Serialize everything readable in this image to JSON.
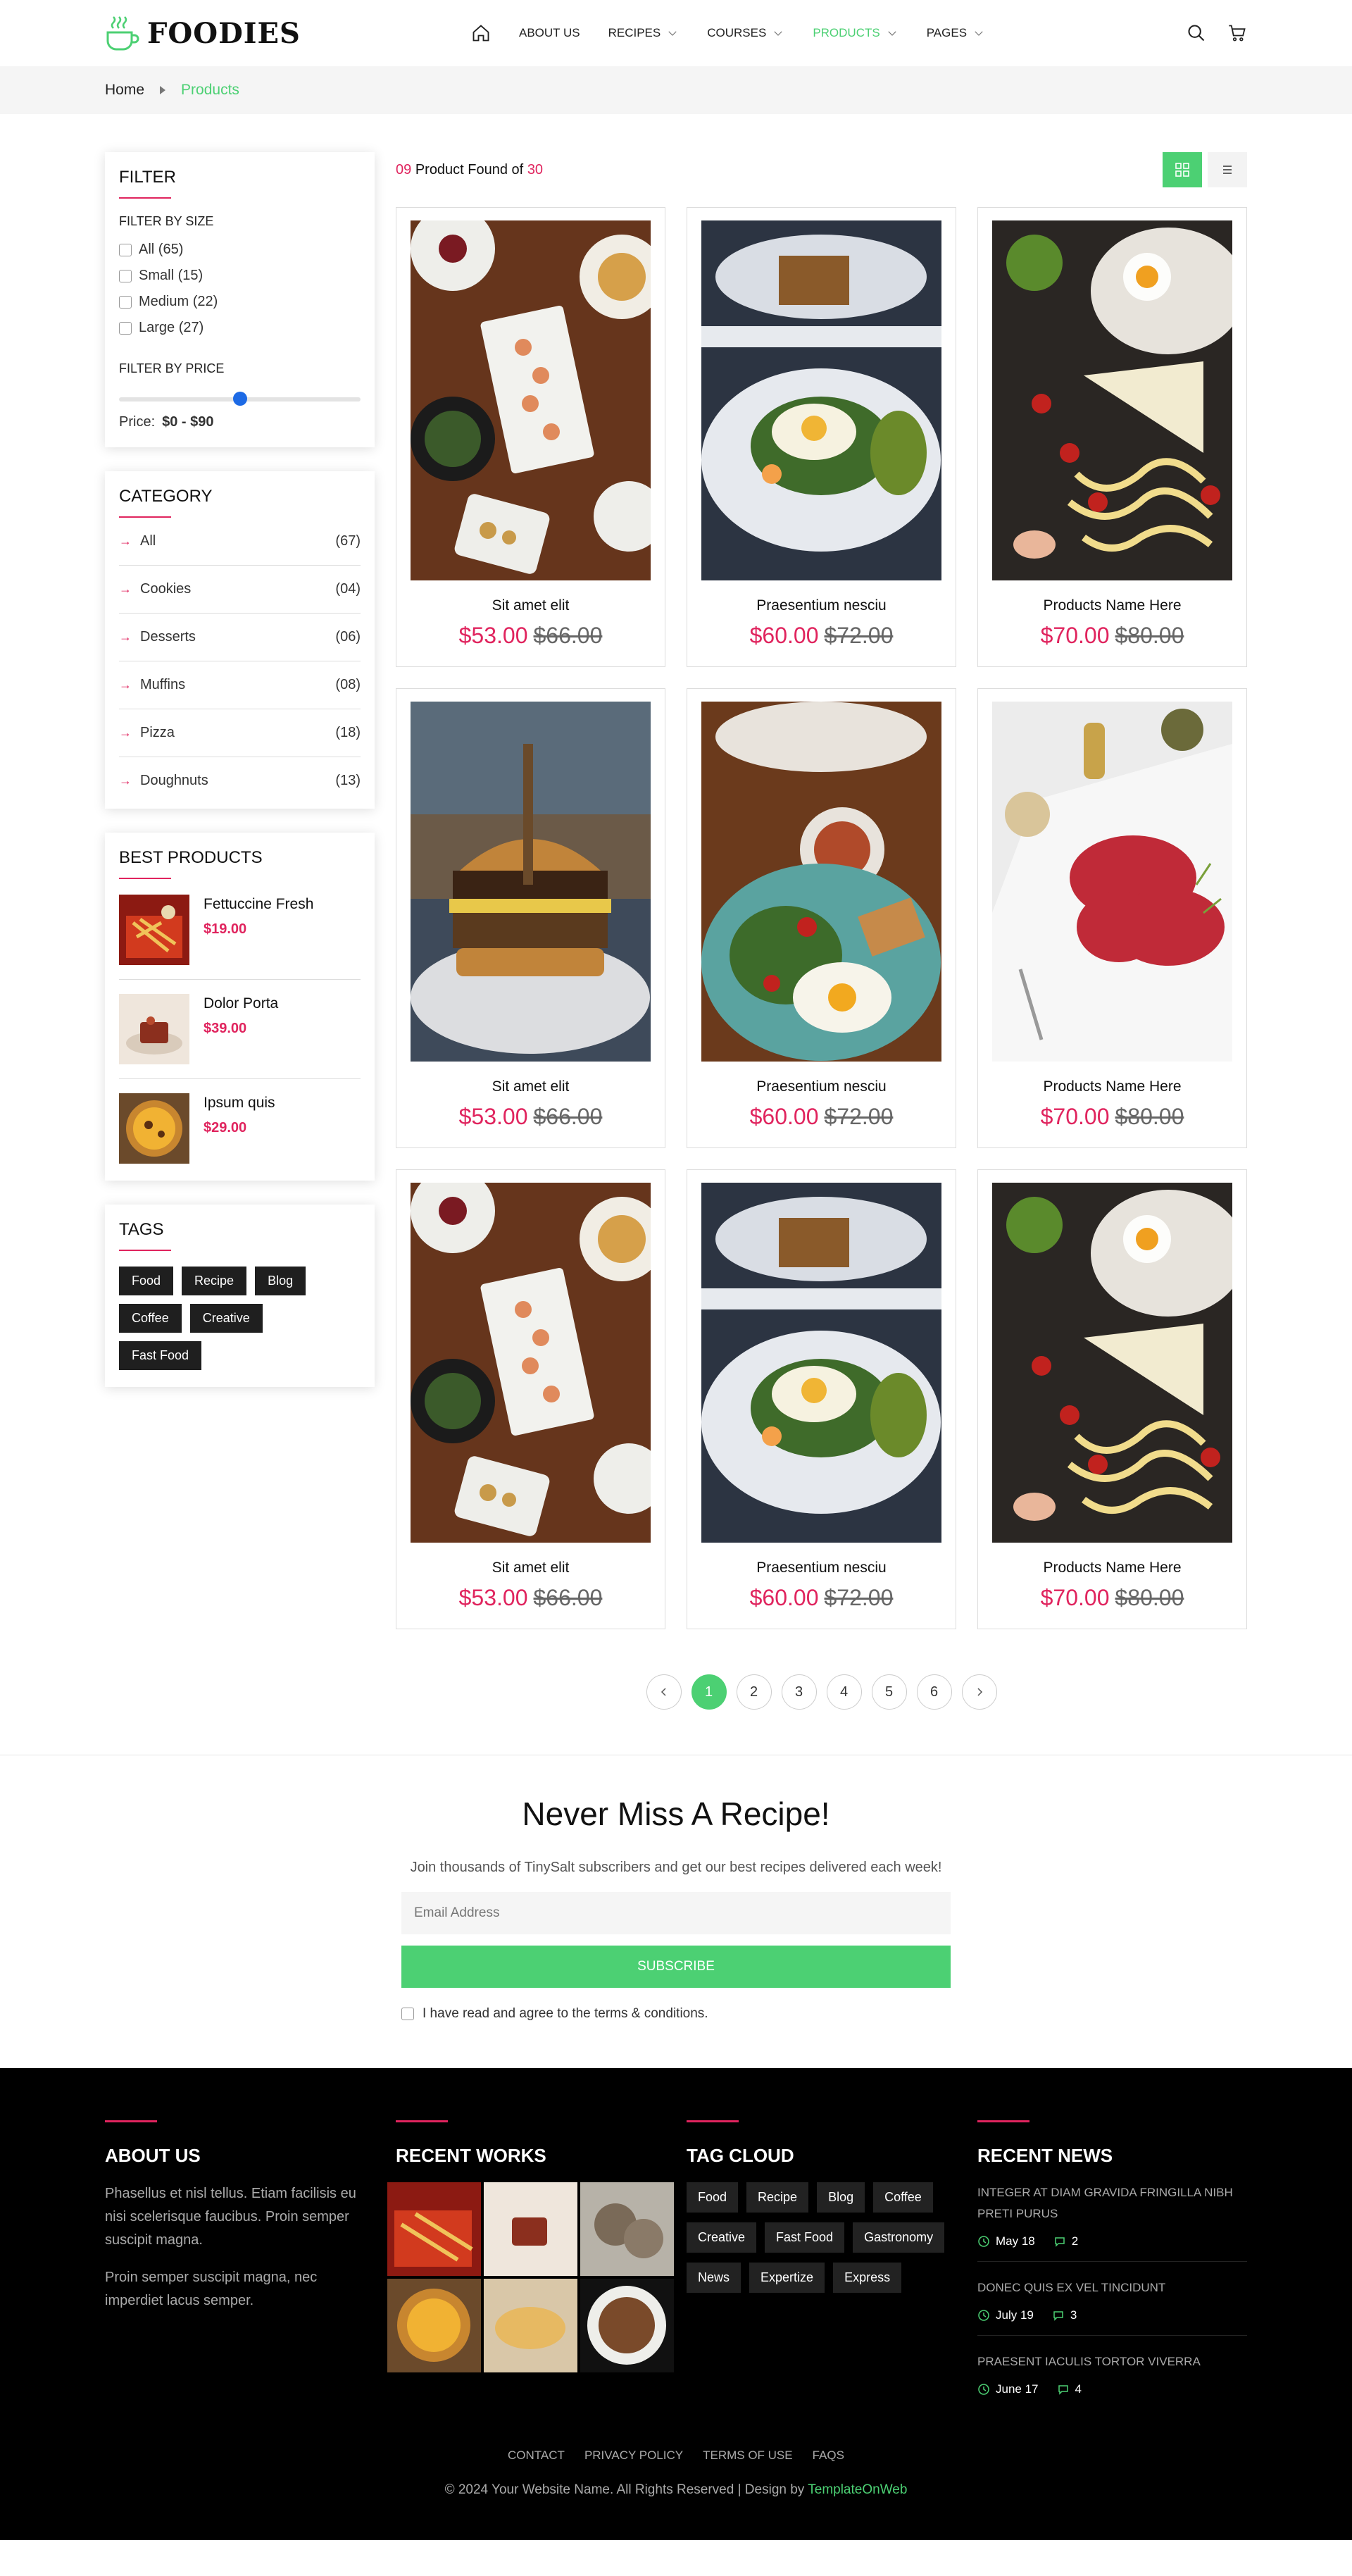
{
  "brand": {
    "name": "FOODIES",
    "accent": "#4cd073",
    "highlight": "#e0245e"
  },
  "nav": [
    {
      "label": "About Us",
      "dropdown": false,
      "active": false
    },
    {
      "label": "Recipes",
      "dropdown": true,
      "active": false
    },
    {
      "label": "Courses",
      "dropdown": true,
      "active": false
    },
    {
      "label": "Products",
      "dropdown": true,
      "active": true
    },
    {
      "label": "Pages",
      "dropdown": true,
      "active": false
    }
  ],
  "breadcrumb": {
    "home": "Home",
    "current": "Products"
  },
  "filter": {
    "title": "Filter",
    "size_title": "Filter by size",
    "sizes": [
      "All (65)",
      "Small (15)",
      "Medium (22)",
      "Large (27)"
    ],
    "price_title": "Filter by price",
    "price_label": "Price:",
    "price_value": "$0 - $90",
    "price_slider_fraction": 0.5
  },
  "category": {
    "title": "Category",
    "items": [
      {
        "name": "All",
        "count": "(67)"
      },
      {
        "name": "Cookies",
        "count": "(04)"
      },
      {
        "name": "Desserts",
        "count": "(06)"
      },
      {
        "name": "Muffins",
        "count": "(08)"
      },
      {
        "name": "Pizza",
        "count": "(18)"
      },
      {
        "name": "Doughnuts",
        "count": "(13)"
      }
    ]
  },
  "best_products": {
    "title": "Best Products",
    "items": [
      {
        "name": "Fettuccine Fresh",
        "price": "$19.00"
      },
      {
        "name": "Dolor Porta",
        "price": "$39.00"
      },
      {
        "name": "Ipsum quis",
        "price": "$29.00"
      }
    ]
  },
  "tags": {
    "title": "Tags",
    "items": [
      "Food",
      "Recipe",
      "Blog",
      "Coffee",
      "Creative",
      "Fast Food"
    ]
  },
  "results": {
    "count": "09",
    "text": "Product Found of",
    "total": "30"
  },
  "products": [
    {
      "name": "Sit amet elit",
      "price": "$53.00",
      "old_price": "$66.00",
      "image": "salmon-plate"
    },
    {
      "name": "Praesentium nesciu",
      "price": "$60.00",
      "old_price": "$72.00",
      "image": "egg-salad-plate"
    },
    {
      "name": "Products Name Here",
      "price": "$70.00",
      "old_price": "$80.00",
      "image": "pasta-ingredients"
    },
    {
      "name": "Sit amet elit",
      "price": "$53.00",
      "old_price": "$66.00",
      "image": "burger"
    },
    {
      "name": "Praesentium nesciu",
      "price": "$60.00",
      "old_price": "$72.00",
      "image": "fried-egg-breakfast"
    },
    {
      "name": "Products Name Here",
      "price": "$70.00",
      "old_price": "$80.00",
      "image": "beef-carpaccio"
    },
    {
      "name": "Sit amet elit",
      "price": "$53.00",
      "old_price": "$66.00",
      "image": "salmon-plate"
    },
    {
      "name": "Praesentium nesciu",
      "price": "$60.00",
      "old_price": "$72.00",
      "image": "egg-salad-plate"
    },
    {
      "name": "Products Name Here",
      "price": "$70.00",
      "old_price": "$80.00",
      "image": "pasta-ingredients"
    }
  ],
  "pagination": {
    "pages": [
      "1",
      "2",
      "3",
      "4",
      "5",
      "6"
    ],
    "current": "1"
  },
  "newsletter": {
    "title": "Never Miss A Recipe!",
    "subtitle": "Join thousands of TinySalt subscribers and get our best recipes delivered each week!",
    "placeholder": "Email Address",
    "button": "Subscribe",
    "agree": "I have read and agree to the terms & conditions."
  },
  "footer": {
    "about": {
      "title": "About Us",
      "p1": "Phasellus et nisl tellus. Etiam facilisis eu nisi scelerisque faucibus. Proin semper suscipit magna.",
      "p2": "Proin semper suscipit magna, nec imperdiet lacus semper."
    },
    "works_title": "Recent Works",
    "tag_cloud": {
      "title": "Tag Cloud",
      "items": [
        "Food",
        "Recipe",
        "Blog",
        "Coffee",
        "Creative",
        "Fast Food",
        "Gastronomy",
        "News",
        "Expertize",
        "Express"
      ]
    },
    "news": {
      "title": "Recent News",
      "items": [
        {
          "title": "Integer at diam gravida fringilla nibh preti purus",
          "date": "May 18",
          "comments": "2"
        },
        {
          "title": "Donec quis ex vel tincidunt",
          "date": "July 19",
          "comments": "3"
        },
        {
          "title": "Praesent iaculis tortor viverra",
          "date": "June 17",
          "comments": "4"
        }
      ]
    },
    "links": [
      "Contact",
      "Privacy Policy",
      "Terms of Use",
      "FAQs"
    ],
    "copyright": "© 2024 Your Website Name. All Rights Reserved | Design by",
    "designer": "TemplateOnWeb"
  }
}
